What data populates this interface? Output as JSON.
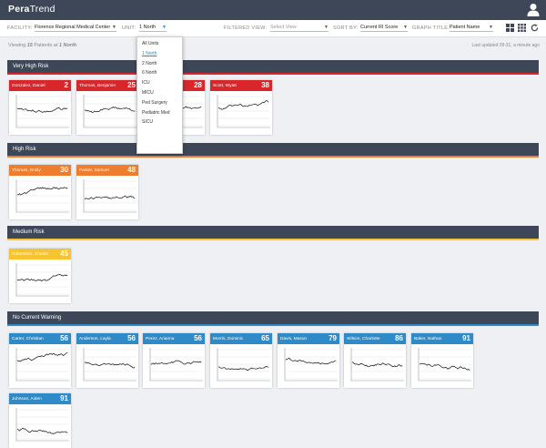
{
  "app": {
    "logo_bold": "Pera",
    "logo_light": "Trend"
  },
  "filters": {
    "facility_label": "FACILITY:",
    "facility_value": "Florence Regional Medical Center",
    "unit_label": "UNIT:",
    "unit_value": "1 North",
    "filtered_view_label": "FILTERED VIEW:",
    "filtered_view_placeholder": "Select View",
    "sort_by_label": "SORT BY:",
    "sort_by_value": "Current RI Score",
    "graph_title_label": "GRAPH TITLE:",
    "graph_title_value": "Patient Name"
  },
  "unit_dropdown": {
    "options": [
      "All Units",
      "1 North",
      "2 North",
      "6 North",
      "ICU",
      "MICU",
      "Ped Surgery",
      "Pediatric Med",
      "SICU"
    ],
    "highlighted": "1 North"
  },
  "status": {
    "viewing_prefix": "Viewing",
    "viewing_count": "15",
    "viewing_mid": "Patients at",
    "viewing_unit": "1 North",
    "last_updated": "Last updated 09:31, a minute ago"
  },
  "colors": {
    "very_high": "#d9262b",
    "high": "#ef7d2e",
    "medium": "#f7c331",
    "none": "#2e8bc8",
    "header": "#3d4758"
  },
  "icons": [
    "user-icon",
    "tile-view-icon",
    "grid-view-icon",
    "refresh-icon"
  ],
  "sections": [
    {
      "title": "Very High Risk",
      "level": "very_high",
      "patients": [
        {
          "name": "Gonzalez, Daniel",
          "score": "2"
        },
        {
          "name": "Thomas, Benjamin",
          "score": "25"
        },
        {
          "name": "",
          "score": "28"
        },
        {
          "name": "Scott, Wyatt",
          "score": "38"
        }
      ]
    },
    {
      "title": "High Risk",
      "level": "high",
      "patients": [
        {
          "name": "Thomas, Emily",
          "score": "30"
        },
        {
          "name": "Parker, Samuel",
          "score": "48"
        }
      ]
    },
    {
      "title": "Medium Risk",
      "level": "medium",
      "patients": [
        {
          "name": "Robertson, Charlie",
          "score": "45"
        }
      ]
    },
    {
      "title": "No Current Warning",
      "level": "none",
      "patients": [
        {
          "name": "Carter, Christian",
          "score": "56"
        },
        {
          "name": "Anderson, Layla",
          "score": "56"
        },
        {
          "name": "Perez, Arianna",
          "score": "56"
        },
        {
          "name": "Morris, Dominic",
          "score": "65"
        },
        {
          "name": "Davis, Mason",
          "score": "79"
        },
        {
          "name": "Wilson, Charlotte",
          "score": "86"
        },
        {
          "name": "Baker, Nathan",
          "score": "91"
        },
        {
          "name": "Johnson, Aiden",
          "score": "91"
        }
      ]
    }
  ]
}
